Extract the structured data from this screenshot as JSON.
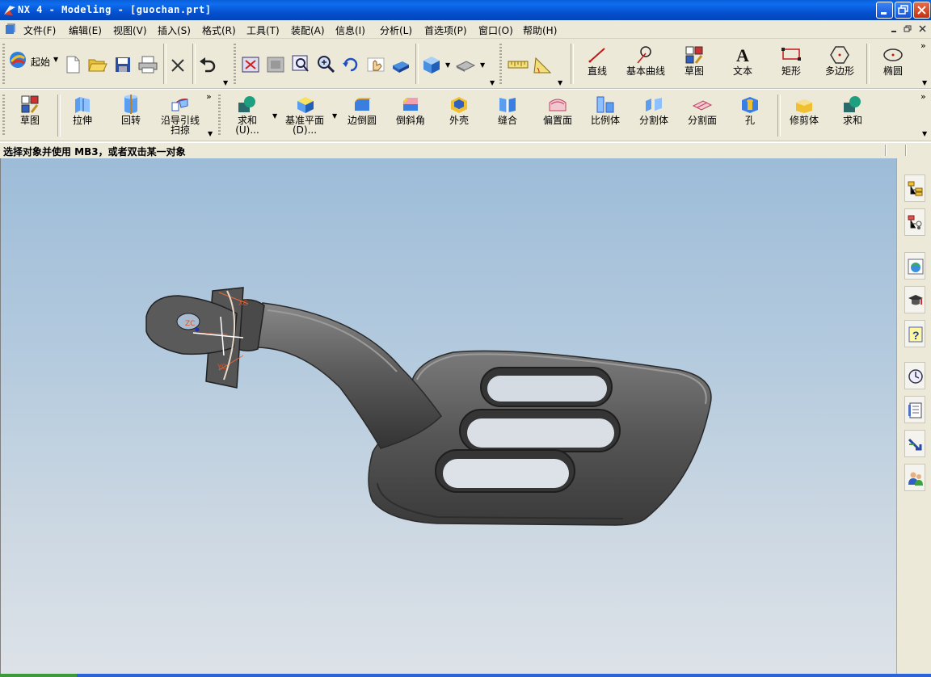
{
  "window": {
    "title": "NX 4 - Modeling - [guochan.prt]",
    "controls": [
      "minimize",
      "restore",
      "close"
    ]
  },
  "menu": {
    "items": [
      "文件(F)",
      "编辑(E)",
      "视图(V)",
      "插入(S)",
      "格式(R)",
      "工具(T)",
      "装配(A)",
      "信息(I)",
      "分析(L)",
      "首选项(P)",
      "窗口(O)",
      "帮助(H)"
    ]
  },
  "toolbar1": {
    "start_label": "起始",
    "curve_tools": [
      "直线",
      "基本曲线",
      "草图",
      "文本",
      "矩形",
      "多边形",
      "椭圆"
    ]
  },
  "toolbar2": {
    "features": [
      "草图",
      "拉伸",
      "回转",
      "沿导引线扫掠"
    ],
    "features_line1": "沿导引线",
    "features_line2": "扫掠",
    "ops": [
      {
        "line1": "求和",
        "line2": "(U)..."
      },
      {
        "line1": "基准平面",
        "line2": "(D)..."
      }
    ],
    "more": [
      "边倒圆",
      "倒斜角",
      "外壳",
      "缝合",
      "偏置面",
      "比例体",
      "分割体",
      "分割面",
      "孔"
    ],
    "last": [
      "修剪体",
      "求和"
    ]
  },
  "status": {
    "prompt": "选择对象并使用 MB3，或者双击某一对象"
  },
  "viewport": {
    "csys_labels": [
      "ZC",
      "XC",
      "YC"
    ]
  },
  "colors": {
    "titlebar": "#0552d0",
    "model": "#505050",
    "viewport_top": "#9dbcd8",
    "viewport_bottom": "#dde2e8"
  }
}
